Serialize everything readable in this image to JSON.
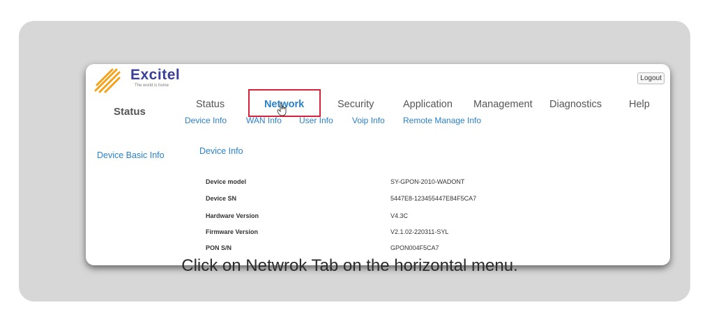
{
  "brand": {
    "name": "Excitel",
    "tagline": "The world is home",
    "logo_color": "#3a3f99",
    "logo_mark_color": "#f2a31b"
  },
  "header": {
    "logout_label": "Logout"
  },
  "sidebar": {
    "title": "Status",
    "link": "Device Basic Info"
  },
  "menu": {
    "items": [
      {
        "label": "Status"
      },
      {
        "label": "Network",
        "selected": true
      },
      {
        "label": "Security"
      },
      {
        "label": "Application"
      },
      {
        "label": "Management"
      },
      {
        "label": "Diagnostics"
      },
      {
        "label": "Help"
      }
    ],
    "sub_items": [
      {
        "label": "Device Info"
      },
      {
        "label": "WAN Info"
      },
      {
        "label": "User Info"
      },
      {
        "label": "Voip Info"
      },
      {
        "label": "Remote Manage Info"
      }
    ]
  },
  "content": {
    "section_title": "Device Info",
    "rows": [
      {
        "label": "Device model",
        "value": "SY-GPON-2010-WADONT"
      },
      {
        "label": "Device SN",
        "value": "5447E8-123455447E84F5CA7"
      },
      {
        "label": "Hardware Version",
        "value": "V4.3C"
      },
      {
        "label": "Firmware Version",
        "value": "V2.1.02-220311-SYL"
      },
      {
        "label": "PON S/N",
        "value": "GPON004F5CA7"
      }
    ]
  },
  "caption": "Click on Netwrok Tab on the horizontal menu.",
  "colors": {
    "highlight": "#d8203a",
    "link": "#2a80c8",
    "card_bg": "#d7d7d7"
  }
}
